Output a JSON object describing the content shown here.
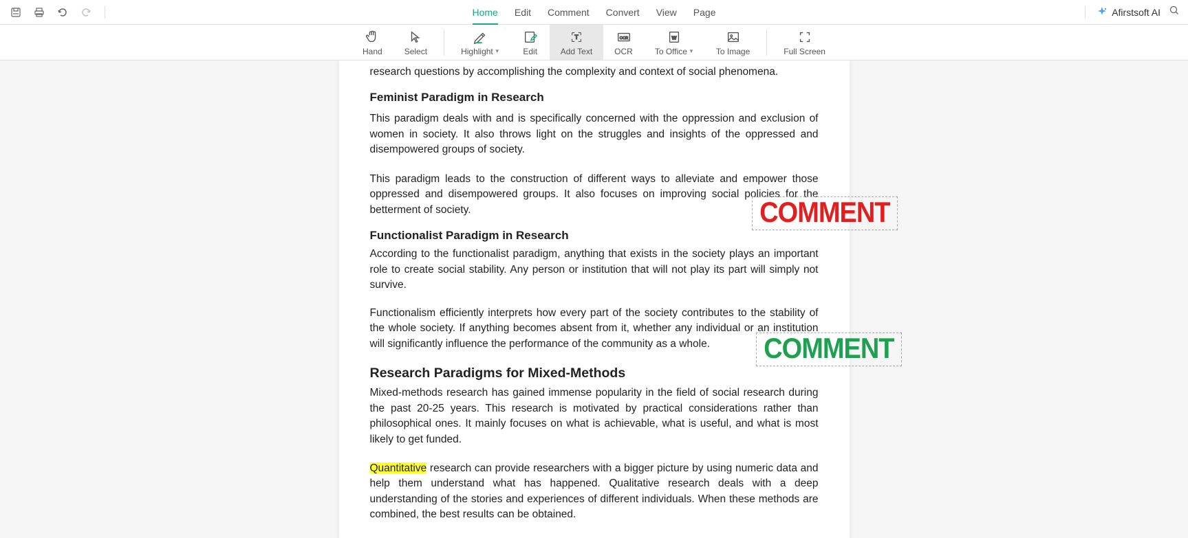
{
  "menuTabs": {
    "home": "Home",
    "edit": "Edit",
    "comment": "Comment",
    "convert": "Convert",
    "view": "View",
    "page": "Page"
  },
  "aiButton": "Afirstsoft AI",
  "ribbon": {
    "hand": "Hand",
    "select": "Select",
    "highlight": "Highlight",
    "edit": "Edit",
    "addText": "Add Text",
    "ocr": "OCR",
    "toOffice": "To Office",
    "toImage": "To Image",
    "fullScreen": "Full Screen"
  },
  "document": {
    "para0": "research questions by accomplishing the complexity and context of social phenomena.",
    "h3a": "Feminist Paradigm in Research",
    "para1": "This paradigm deals with and is specifically concerned with the oppression and exclusion of women in society. It also throws light on the struggles and insights of the oppressed and disempowered groups of society.",
    "para2": "This paradigm leads to the construction of different ways to alleviate and empower those oppressed and disempowered groups. It also focuses on improving social policies for the betterment of society.",
    "h3b": "Functionalist Paradigm in Research",
    "para3": "According to the functionalist paradigm, anything that exists in the society plays an important role to create social stability. Any person or institution that will not play its part will simply not survive.",
    "para4": "Functionalism efficiently interprets how every part of the society contributes to the stability of the whole society. If anything becomes absent from it, whether any individual or an institution will significantly influence the performance of the community as a whole.",
    "h2a": "Research Paradigms for Mixed-Methods",
    "para5": "Mixed-methods research has gained immense popularity in the field of social research during the past 20-25 years. This research is motivated by practical considerations rather than philosophical ones. It mainly focuses on what is achievable, what is useful, and what is most likely to get funded.",
    "para6_highlight": "Quantitative",
    "para6_rest": " research can provide researchers with a bigger picture by using numeric data and help them understand what has happened. Qualitative research deals with a deep understanding of the stories and experiences of different individuals. When these methods are combined, the best results can be obtained.",
    "commentStamp": "COMMENT"
  }
}
